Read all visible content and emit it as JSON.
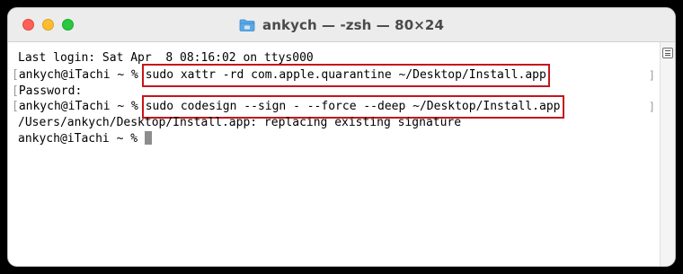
{
  "window": {
    "title": "ankych — -zsh — 80×24"
  },
  "terminal": {
    "lines": {
      "last_login": "Last login: Sat Apr  8 08:16:02 on ttys000",
      "prompt1": "ankych@iTachi ~ % ",
      "cmd1": "sudo xattr -rd com.apple.quarantine ~/Desktop/Install.app",
      "password": "Password:",
      "prompt2": "ankych@iTachi ~ % ",
      "cmd2": "sudo codesign --sign - --force --deep ~/Desktop/Install.app",
      "output": "/Users/ankych/Desktop/Install.app: replacing existing signature",
      "prompt3": "ankych@iTachi ~ % "
    },
    "bracket_left": "[",
    "bracket_right": "]"
  },
  "colors": {
    "highlight_box": "#c4161c",
    "close": "#fe5f57",
    "minimize": "#febc2e",
    "maximize": "#28c840"
  },
  "icons": {
    "titlebar": "folder-icon",
    "scrollbar": "list-icon"
  }
}
